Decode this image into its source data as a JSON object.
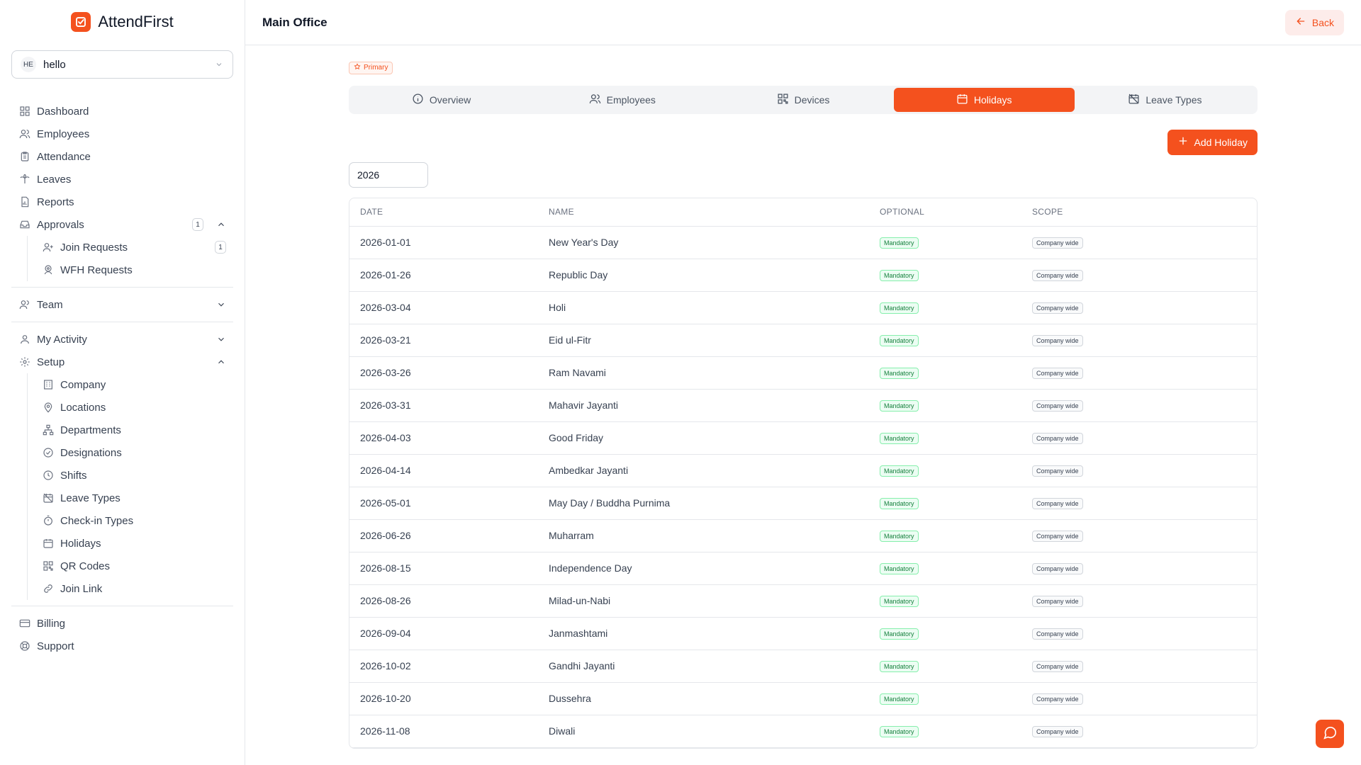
{
  "brand": {
    "name": "AttendFirst"
  },
  "org": {
    "initials": "HE",
    "name": "hello"
  },
  "sidebar": {
    "items": [
      {
        "label": "Dashboard"
      },
      {
        "label": "Employees"
      },
      {
        "label": "Attendance"
      },
      {
        "label": "Leaves"
      },
      {
        "label": "Reports"
      },
      {
        "label": "Approvals",
        "count": "1"
      },
      {
        "label": "Join Requests",
        "count": "1"
      },
      {
        "label": "WFH Requests"
      },
      {
        "label": "Team"
      },
      {
        "label": "My Activity"
      },
      {
        "label": "Setup"
      },
      {
        "label": "Company"
      },
      {
        "label": "Locations"
      },
      {
        "label": "Departments"
      },
      {
        "label": "Designations"
      },
      {
        "label": "Shifts"
      },
      {
        "label": "Leave Types"
      },
      {
        "label": "Check-in Types"
      },
      {
        "label": "Holidays"
      },
      {
        "label": "QR Codes"
      },
      {
        "label": "Join Link"
      },
      {
        "label": "Billing"
      },
      {
        "label": "Support"
      }
    ]
  },
  "header": {
    "title": "Main Office",
    "back_label": "Back"
  },
  "location": {
    "badge": "Primary"
  },
  "tabs": [
    {
      "label": "Overview"
    },
    {
      "label": "Employees"
    },
    {
      "label": "Devices"
    },
    {
      "label": "Holidays"
    },
    {
      "label": "Leave Types"
    }
  ],
  "add_holiday_label": "Add Holiday",
  "year_value": "2026",
  "table": {
    "headers": [
      "DATE",
      "NAME",
      "OPTIONAL",
      "SCOPE"
    ],
    "rows": [
      {
        "date": "2026-01-01",
        "name": "New Year's Day",
        "optional": "Mandatory",
        "scope": "Company wide"
      },
      {
        "date": "2026-01-26",
        "name": "Republic Day",
        "optional": "Mandatory",
        "scope": "Company wide"
      },
      {
        "date": "2026-03-04",
        "name": "Holi",
        "optional": "Mandatory",
        "scope": "Company wide"
      },
      {
        "date": "2026-03-21",
        "name": "Eid ul-Fitr",
        "optional": "Mandatory",
        "scope": "Company wide"
      },
      {
        "date": "2026-03-26",
        "name": "Ram Navami",
        "optional": "Mandatory",
        "scope": "Company wide"
      },
      {
        "date": "2026-03-31",
        "name": "Mahavir Jayanti",
        "optional": "Mandatory",
        "scope": "Company wide"
      },
      {
        "date": "2026-04-03",
        "name": "Good Friday",
        "optional": "Mandatory",
        "scope": "Company wide"
      },
      {
        "date": "2026-04-14",
        "name": "Ambedkar Jayanti",
        "optional": "Mandatory",
        "scope": "Company wide"
      },
      {
        "date": "2026-05-01",
        "name": "May Day / Buddha Purnima",
        "optional": "Mandatory",
        "scope": "Company wide"
      },
      {
        "date": "2026-06-26",
        "name": "Muharram",
        "optional": "Mandatory",
        "scope": "Company wide"
      },
      {
        "date": "2026-08-15",
        "name": "Independence Day",
        "optional": "Mandatory",
        "scope": "Company wide"
      },
      {
        "date": "2026-08-26",
        "name": "Milad-un-Nabi",
        "optional": "Mandatory",
        "scope": "Company wide"
      },
      {
        "date": "2026-09-04",
        "name": "Janmashtami",
        "optional": "Mandatory",
        "scope": "Company wide"
      },
      {
        "date": "2026-10-02",
        "name": "Gandhi Jayanti",
        "optional": "Mandatory",
        "scope": "Company wide"
      },
      {
        "date": "2026-10-20",
        "name": "Dussehra",
        "optional": "Mandatory",
        "scope": "Company wide"
      },
      {
        "date": "2026-11-08",
        "name": "Diwali",
        "optional": "Mandatory",
        "scope": "Company wide"
      }
    ]
  },
  "colors": {
    "accent": "#f4511e",
    "mandatory": "#15803d"
  }
}
